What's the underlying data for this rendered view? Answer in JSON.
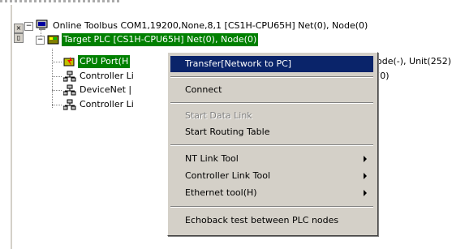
{
  "tree": {
    "root": {
      "label": "Online Toolbus COM1,19200,None,8,1 [CS1H-CPU65H] Net(0), Node(0)",
      "expander": "−"
    },
    "plc": {
      "label": "Target PLC [CS1H-CPU65H] Net(0), Node(0)",
      "expander": "−"
    },
    "children": [
      {
        "label": "CPU Port(H",
        "tail": "ode(-), Unit(252)"
      },
      {
        "label": "Controller Li",
        "tail": "(0)"
      },
      {
        "label": "DeviceNet |",
        "tail": ""
      },
      {
        "label": "Controller Li",
        "tail": ""
      }
    ]
  },
  "side": {
    "close": "×",
    "pin": "▯"
  },
  "context_menu": {
    "items": [
      {
        "label": "Transfer[Network to PC]",
        "highlighted": true
      },
      {
        "label": "Connect"
      },
      {
        "label": "Start Data Link",
        "disabled": true
      },
      {
        "label": "Start Routing Table"
      },
      {
        "label": "NT Link Tool",
        "submenu": true
      },
      {
        "label": "Controller Link Tool",
        "submenu": true
      },
      {
        "label": "Ethernet tool(H)",
        "submenu": true
      },
      {
        "label": "Echoback test between PLC nodes"
      }
    ]
  },
  "colors": {
    "selection": "#008000",
    "menu_highlight": "#0a246a",
    "menu_bg": "#d4d0c8"
  }
}
